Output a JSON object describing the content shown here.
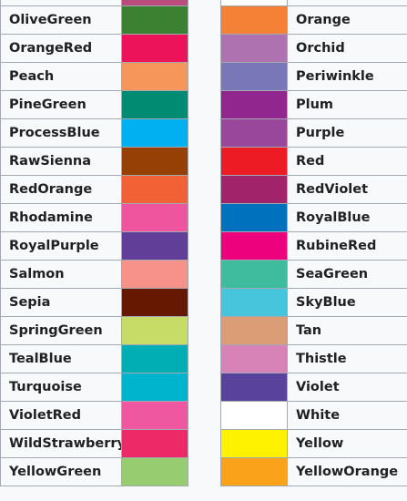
{
  "colors": [
    {
      "left": {
        "name": "OliveGreen",
        "hex": "#3c8031"
      },
      "right": {
        "name": "Orange",
        "hex": "#f58137"
      }
    },
    {
      "left": {
        "name": "OrangeRed",
        "hex": "#ed135a"
      },
      "right": {
        "name": "Orchid",
        "hex": "#af72b0"
      }
    },
    {
      "left": {
        "name": "Peach",
        "hex": "#f7965a"
      },
      "right": {
        "name": "Periwinkle",
        "hex": "#7977b8"
      }
    },
    {
      "left": {
        "name": "PineGreen",
        "hex": "#008b72"
      },
      "right": {
        "name": "Plum",
        "hex": "#92268f"
      }
    },
    {
      "left": {
        "name": "ProcessBlue",
        "hex": "#00b0f0"
      },
      "right": {
        "name": "Purple",
        "hex": "#99479b"
      }
    },
    {
      "left": {
        "name": "RawSienna",
        "hex": "#974006"
      },
      "right": {
        "name": "Red",
        "hex": "#ed1b23"
      }
    },
    {
      "left": {
        "name": "RedOrange",
        "hex": "#f26035"
      },
      "right": {
        "name": "RedViolet",
        "hex": "#a1246b"
      }
    },
    {
      "left": {
        "name": "Rhodamine",
        "hex": "#ef559f"
      },
      "right": {
        "name": "RoyalBlue",
        "hex": "#0071bc"
      }
    },
    {
      "left": {
        "name": "RoyalPurple",
        "hex": "#613f99"
      },
      "right": {
        "name": "RubineRed",
        "hex": "#ed017d"
      }
    },
    {
      "left": {
        "name": "Salmon",
        "hex": "#f69289"
      },
      "right": {
        "name": "SeaGreen",
        "hex": "#3fbc9d"
      }
    },
    {
      "left": {
        "name": "Sepia",
        "hex": "#671800"
      },
      "right": {
        "name": "SkyBlue",
        "hex": "#46c5dd"
      }
    },
    {
      "left": {
        "name": "SpringGreen",
        "hex": "#c6dc67"
      },
      "right": {
        "name": "Tan",
        "hex": "#da9d76"
      }
    },
    {
      "left": {
        "name": "TealBlue",
        "hex": "#00aeb3"
      },
      "right": {
        "name": "Thistle",
        "hex": "#d883b7"
      }
    },
    {
      "left": {
        "name": "Turquoise",
        "hex": "#00b4ce"
      },
      "right": {
        "name": "Violet",
        "hex": "#58429b"
      }
    },
    {
      "left": {
        "name": "VioletRed",
        "hex": "#ef58a0"
      },
      "right": {
        "name": "White",
        "hex": "#ffffff"
      }
    },
    {
      "left": {
        "name": "WildStrawberry",
        "hex": "#ee2967"
      },
      "right": {
        "name": "Yellow",
        "hex": "#fff200"
      }
    },
    {
      "left": {
        "name": "YellowGreen",
        "hex": "#98cc70"
      },
      "right": {
        "name": "YellowOrange",
        "hex": "#faa21a"
      }
    }
  ],
  "background_color": "#f8f9fa",
  "border_color": "#a2a9b1"
}
